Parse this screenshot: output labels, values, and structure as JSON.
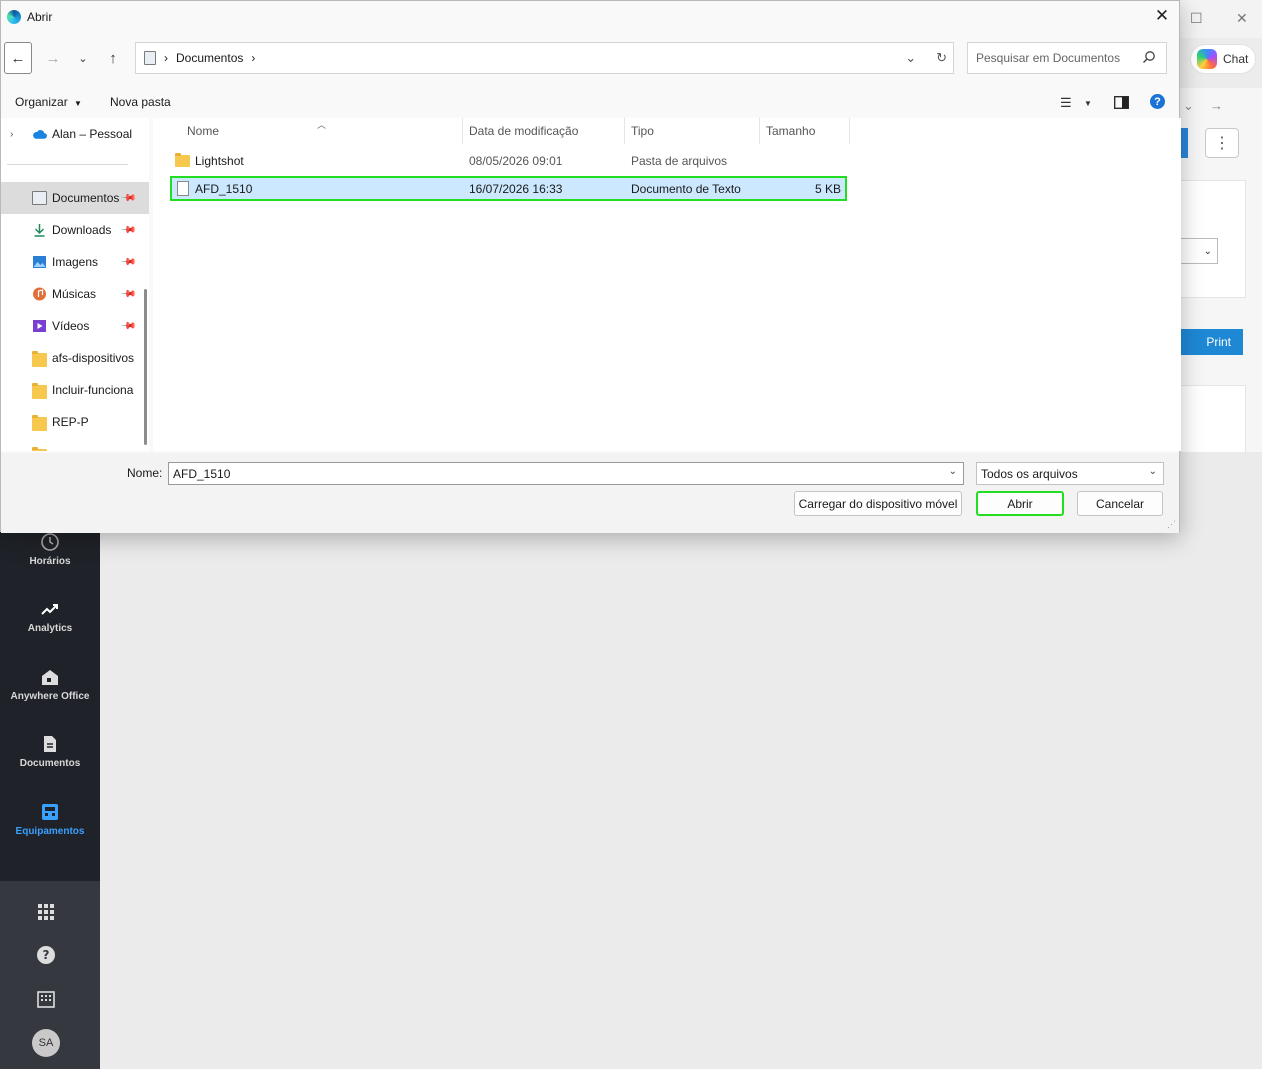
{
  "dialog": {
    "title": "Abrir",
    "address": {
      "crumb": "Documentos",
      "separator": "›"
    },
    "search_placeholder": "Pesquisar em Documentos",
    "toolbar": {
      "organize": "Organizar",
      "new_folder": "Nova pasta"
    },
    "nav_pane": [
      {
        "label": "Alan – Pessoal",
        "icon": "onedrive-icon",
        "pinned": false,
        "expandable": true
      },
      {
        "label": "Documentos",
        "icon": "documents-icon",
        "pinned": true,
        "selected": true
      },
      {
        "label": "Downloads",
        "icon": "download-icon",
        "pinned": true
      },
      {
        "label": "Imagens",
        "icon": "pictures-icon",
        "pinned": true
      },
      {
        "label": "Músicas",
        "icon": "music-icon",
        "pinned": true
      },
      {
        "label": "Vídeos",
        "icon": "videos-icon",
        "pinned": true
      },
      {
        "label": "afs-dispositivos",
        "icon": "folder-icon",
        "pinned": false
      },
      {
        "label": "Incluir-funciona",
        "icon": "folder-icon",
        "pinned": false
      },
      {
        "label": "REP-P",
        "icon": "folder-icon",
        "pinned": false
      }
    ],
    "columns": [
      "Nome",
      "Data de modificação",
      "Tipo",
      "Tamanho"
    ],
    "files": [
      {
        "name": "Lightshot",
        "modified": "08/05/2026 09:01",
        "type": "Pasta de arquivos",
        "size": "",
        "icon": "folder-icon",
        "selected": false
      },
      {
        "name": "AFD_1510",
        "modified": "16/07/2026 16:33",
        "type": "Documento de Texto",
        "size": "5 KB",
        "icon": "text-file-icon",
        "selected": true
      }
    ],
    "name_label": "Nome:",
    "name_value": "AFD_1510",
    "file_type": "Todos os arquivos",
    "buttons": {
      "mobile": "Carregar do dispositivo móvel",
      "open": "Abrir",
      "cancel": "Cancelar"
    }
  },
  "background_app": {
    "chat_label": "Chat",
    "print_label": "Print",
    "sidebar": [
      {
        "label": "Horários",
        "icon": "clock-icon"
      },
      {
        "label": "Analytics",
        "icon": "trend-icon"
      },
      {
        "label": "Anywhere Office",
        "icon": "home-office-icon"
      },
      {
        "label": "Documentos",
        "icon": "document-icon"
      },
      {
        "label": "Equipamentos",
        "icon": "device-icon",
        "active": true
      }
    ],
    "avatar_initials": "SA",
    "accent_color": "#3aa0ff"
  }
}
